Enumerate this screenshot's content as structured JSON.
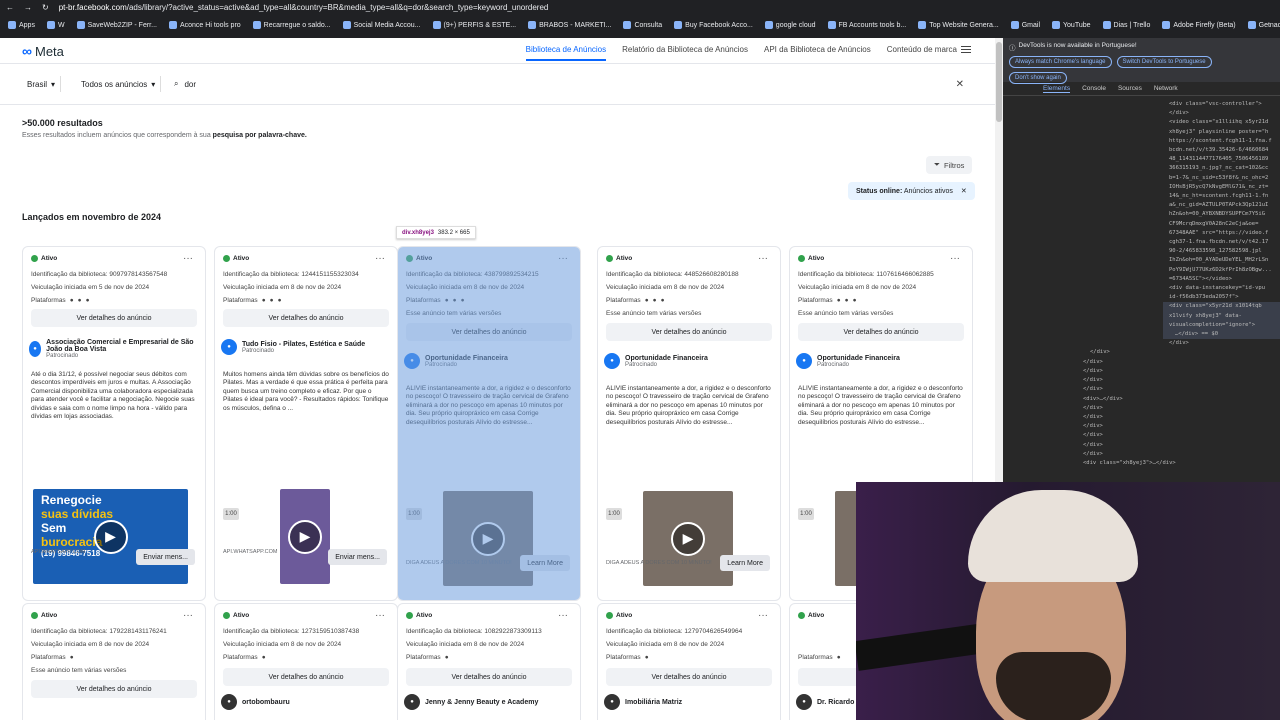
{
  "browser": {
    "url_host": "pt-br.facebook.com",
    "url_path": "/ads/library/?active_status=active&ad_type=all&country=BR&media_type=all&q=dor&search_type=keyword_unordered",
    "bookmarks": [
      "Apps",
      "W",
      "SaveWeb2ZIP - Ferr...",
      "Aconce Hi tools pro",
      "Recarregue o saldo...",
      "Social Media Accou...",
      "(9+) PERFIS & ESTE...",
      "BRABOS - MARKETI...",
      "Consulta",
      "Buy Facebook Acco...",
      "google cloud",
      "FB Accounts tools b...",
      "Top Website Genera...",
      "Gmail",
      "YouTube",
      "Dias | Trello",
      "Adobe Firefly (Beta)",
      "Getnada",
      "Todos os favoritos"
    ]
  },
  "header": {
    "logo": "Meta",
    "nav": [
      "Biblioteca de Anúncios",
      "Relatório da Biblioteca de Anúncios",
      "API da Biblioteca de Anúncios",
      "Conteúdo de marca"
    ]
  },
  "filters": {
    "country": "Brasil",
    "ad_type": "Todos os anúncios",
    "query": "dor"
  },
  "results": {
    "count": ">50.000 resultados",
    "sub_prefix": "Esses resultados incluem anúncios que correspondem à sua ",
    "sub_bold": "pesquisa por palavra-chave.",
    "filtros": "Filtros",
    "status_label": "Status online:",
    "status_value": "Anúncios ativos",
    "section_title": "Lançados em novembro de 2024"
  },
  "tooltip": {
    "selector": "div.xh8yej3",
    "size": "383.2 × 665"
  },
  "cards": [
    {
      "status": "Ativo",
      "id": "Identificação da biblioteca: 9097978143567548",
      "started": "Veiculação iniciada em 5 de nov de 2024",
      "platforms": "Plataformas",
      "versions": "",
      "button": "Ver detalhes do anúncio",
      "advertiser": "Associação Comercial e Empresarial de São João da Boa Vista",
      "sponsored": "Patrocinado",
      "body": "Até o dia 31/12, é possível negociar seus débitos com descontos imperdíveis em juros e multas. A Associação Comercial disponibiliza uma colaboradora especializada para atender você e facilitar a negociação. Negocie suas dívidas e saia com o nome limpo na hora - válido para dívidas em lojas associadas.",
      "duration": "",
      "media_text": [
        "Renegocie",
        "suas dívidas",
        "Sem",
        "burocracia",
        "(19) 99846-7518"
      ],
      "cta": "Enviar mens...",
      "footer": "API.WHATSAPP.COM"
    },
    {
      "status": "Ativo",
      "id": "Identificação da biblioteca: 1244151155323034",
      "started": "Veiculação iniciada em 8 de nov de 2024",
      "platforms": "Plataformas",
      "versions": "",
      "button": "Ver detalhes do anúncio",
      "advertiser": "Tudo Fisio - Pilates, Estética e Saúde",
      "sponsored": "Patrocinado",
      "body": "Muitos homens ainda têm dúvidas sobre os benefícios do Pilates. Mas a verdade é que essa prática é perfeita para quem busca um treino completo e eficaz. Por que o Pilates é ideal para você? - Resultados rápidos: Tonifique os músculos, defina o ...",
      "duration": "1:00",
      "cta": "Enviar mens...",
      "footer": "API.WHATSAPP.COM"
    },
    {
      "status": "Ativo",
      "id": "Identificação da biblioteca: 438799892534215",
      "started": "Veiculação iniciada em 8 de nov de 2024",
      "platforms": "Plataformas",
      "versions": "Esse anúncio tem várias versões",
      "button": "Ver detalhes do anúncio",
      "advertiser": "Oportunidade Financeira",
      "sponsored": "Patrocinado",
      "body": "ALIVIE instantaneamente a dor, a rigidez e o desconforto no pescoço! O travesseiro de tração cervical de Grafeno eliminará a dor no pescoço em apenas 10 minutos por dia. Seu próprio quiropráxico em casa Corrige desequilíbrios posturais Alívio do estresse...",
      "duration": "1:00",
      "cta": "Learn More",
      "footer": "DIGA ADEUS A DORES COM 10 MINUTO!"
    },
    {
      "status": "Ativo",
      "id": "Identificação da biblioteca: 448526608280188",
      "started": "Veiculação iniciada em 8 de nov de 2024",
      "platforms": "Plataformas",
      "versions": "Esse anúncio tem várias versões",
      "button": "Ver detalhes do anúncio",
      "advertiser": "Oportunidade Financeira",
      "sponsored": "Patrocinado",
      "body": "ALIVIE instantaneamente a dor, a rigidez e o desconforto no pescoço! O travesseiro de tração cervical de Grafeno eliminará a dor no pescoço em apenas 10 minutos por dia. Seu próprio quiropráxico em casa Corrige desequilíbrios posturais Alívio do estresse...",
      "duration": "1:00",
      "cta": "Learn More",
      "footer": "DIGA ADEUS A DORES COM 10 MINUTO!"
    },
    {
      "status": "Ativo",
      "id": "Identificação da biblioteca: 1107616466062885",
      "started": "Veiculação iniciada em 8 de nov de 2024",
      "platforms": "Plataformas",
      "versions": "Esse anúncio tem várias versões",
      "button": "Ver detalhes do anúncio",
      "advertiser": "Oportunidade Financeira",
      "sponsored": "Patrocinado",
      "body": "ALIVIE instantaneamente a dor, a rigidez e o desconforto no pescoço! O travesseiro de tração cervical de Grafeno eliminará a dor no pescoço em apenas 10 minutos por dia. Seu próprio quiropráxico em casa Corrige desequilíbrios posturais Alívio do estresse...",
      "duration": "1:00",
      "cta": "",
      "footer": ""
    }
  ],
  "cards_row2": [
    {
      "status": "Ativo",
      "id": "Identificação da biblioteca: 1792281431176241",
      "started": "Veiculação iniciada em 8 de nov de 2024",
      "platforms": "Plataformas",
      "versions": "Esse anúncio tem várias versões",
      "button": "Ver detalhes do anúncio",
      "advertiser": ""
    },
    {
      "status": "Ativo",
      "id": "Identificação da biblioteca: 1273159510387438",
      "started": "Veiculação iniciada em 8 de nov de 2024",
      "platforms": "Plataformas",
      "versions": "",
      "button": "Ver detalhes do anúncio",
      "advertiser": "ortobombauru"
    },
    {
      "status": "Ativo",
      "id": "Identificação da biblioteca: 1082922873309113",
      "started": "Veiculação iniciada em 8 de nov de 2024",
      "platforms": "Plataformas",
      "versions": "",
      "button": "Ver detalhes do anúncio",
      "advertiser": "Jenny & Jenny Beauty e Academy"
    },
    {
      "status": "Ativo",
      "id": "Identificação da biblioteca: 1279704626549964",
      "started": "Veiculação iniciada em 8 de nov de 2024",
      "platforms": "Plataformas",
      "versions": "",
      "button": "Ver detalhes do anúncio",
      "advertiser": "Imobiliária Matriz"
    },
    {
      "status": "Ativo",
      "id": "",
      "started": "",
      "platforms": "Plataformas",
      "versions": "",
      "button": "Ver",
      "advertiser": "Dr. Ricardo"
    }
  ],
  "devtools": {
    "banner": "DevTools is now available in Portuguese!",
    "btn1": "Always match Chrome's language",
    "btn2": "Switch DevTools to Portuguese",
    "btn3": "Don't show again",
    "tabs": [
      "Elements",
      "Console",
      "Sources",
      "Network"
    ],
    "code": [
      "<div class=\"vsc-controller\">",
      "</div>",
      "<video class=\"x1lliihq x5yr21d",
      "xh8yej3\" playsinline poster=\"h",
      "https://scontent.fcgh11-1.fna.f",
      "bcdn.net/v/t39.35426-6/4660684",
      "48_1143114477176405_7506456189",
      "366315193_n.jpg?_nc_cat=102&cc",
      "b=1-7&_nc_sid=c53f8f&_nc_ohc=2",
      "IOHsBjR5ycQ7kNvgEMlG71&_nc_zt=",
      "14&_nc_ht=scontent.fcgh11-1.fn",
      "a&_nc_gid=AZTULP0TAPck3Qp121uI",
      "hZn&oh=00_AYBXNBDYSUPFCm7Y5iG",
      "CF9McrqDmxgV0A28nC2eCja&oe=",
      "67348AAE\" src=\"https://video.f",
      "cgh37-1.fna.fbcdn.net/v/t42.17",
      "90-2/465833598_127582598.jpl",
      "IhZn&oh=00_AYADeUDeYEL_MH2rLSn",
      "PoY9IWjU77UKz6D2kfPrIh8zOBgw...",
      "=6734A5SC\"></video>",
      "<div data-instancekey=\"id-vpu",
      "id-f56db373eda2057f\">",
      "<div class=\"x5yr21d x1014tqb",
      "x1lvify xh8yej3\" data-",
      "visualcompletion=\"ignore\">",
      "…</div> == $0",
      "</div>",
      "</div>",
      "</div>",
      "</div>",
      "</div>",
      "</div>",
      "<div>…</div>",
      "</div>",
      "</div>",
      "</div>",
      "</div>",
      "</div>",
      "</div>",
      "<div class=\"xh8yej3\">…</div>"
    ]
  }
}
